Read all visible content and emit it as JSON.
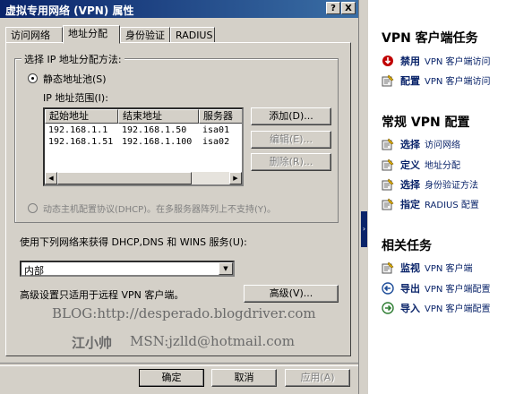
{
  "dialog": {
    "title": "虚拟专用网络 (VPN) 属性",
    "help_btn": "?",
    "close_btn": "X",
    "tabs": [
      "访问网络",
      "地址分配",
      "身份验证",
      "RADIUS"
    ],
    "group_label": "选择 IP 地址分配方法:",
    "static_pool_label": "静态地址池(S)",
    "ip_range_label": "IP 地址范围(I):",
    "columns": [
      "起始地址",
      "结束地址",
      "服务器"
    ],
    "rows": [
      {
        "start": "192.168.1.1",
        "end": "192.168.1.50",
        "server": "isa01"
      },
      {
        "start": "192.168.1.51",
        "end": "192.168.1.100",
        "server": "isa02"
      }
    ],
    "add_btn": "添加(D)...",
    "edit_btn": "编辑(E)...",
    "delete_btn": "删除(R)...",
    "dhcp_label": "动态主机配置协议(DHCP)。在多服务器阵列上不支持(Y)。",
    "network_label": "使用下列网络来获得 DHCP,DNS 和 WINS 服务(U):",
    "network_value": "内部",
    "advanced_label": "高级设置只适用于远程 VPN 客户端。",
    "advanced_btn": "高级(V)...",
    "ok_btn": "确定",
    "cancel_btn": "取消",
    "apply_btn": "应用(A)"
  },
  "watermark": {
    "blog": "BLOG:http://desperado.blogdriver.com",
    "author": "江小帅",
    "msn": "MSN:jzlld@hotmail.com"
  },
  "taskpane": {
    "section1_title": "VPN 客户端任务",
    "section1_items": [
      {
        "verb": "禁用",
        "object": "VPN 客户端访问",
        "icon": "disable-icon"
      },
      {
        "verb": "配置",
        "object": "VPN 客户端访问",
        "icon": "configure-icon"
      }
    ],
    "section2_title": "常规 VPN 配置",
    "section2_items": [
      {
        "verb": "选择",
        "object": "访问网络",
        "icon": "task-icon"
      },
      {
        "verb": "定义",
        "object": "地址分配",
        "icon": "task-icon"
      },
      {
        "verb": "选择",
        "object": "身份验证方法",
        "icon": "task-icon"
      },
      {
        "verb": "指定",
        "object": "RADIUS 配置",
        "icon": "task-icon"
      }
    ],
    "section3_title": "相关任务",
    "section3_items": [
      {
        "verb": "监视",
        "object": "VPN 客户端",
        "icon": "monitor-icon"
      },
      {
        "verb": "导出",
        "object": "VPN 客户端配置",
        "icon": "export-icon"
      },
      {
        "verb": "导入",
        "object": "VPN 客户端配置",
        "icon": "import-icon"
      }
    ]
  },
  "colors": {
    "title_bar": "#0a246a",
    "link": "#0a246a",
    "disable_icon": "#c00000",
    "arrow_icon": "#2e7d32"
  }
}
